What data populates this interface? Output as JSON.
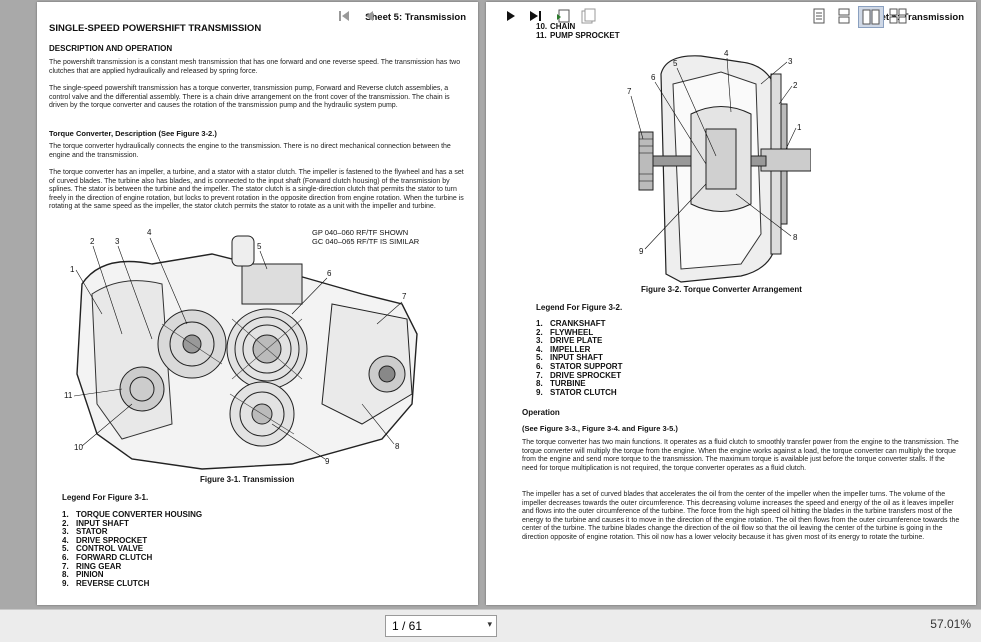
{
  "page1": {
    "sheet": "Sheet 5: Transmission",
    "title": "SINGLE-SPEED POWERSHIFT TRANSMISSION",
    "desc_heading": "DESCRIPTION AND OPERATION",
    "p1": "The powershift transmission is a constant mesh transmission that has one forward and one reverse speed. The transmission has two clutches that are applied hydraulically and released by spring force.",
    "p2": "The single-speed powershift transmission has a torque converter, transmission pump, Forward and Reverse clutch assemblies, a control valve and the differential assembly. There is a chain drive arrangement on the front cover of the transmission. The chain is driven by the torque converter and causes the rotation of the transmission pump and the hydraulic system pump.",
    "tc_heading": "Torque Converter, Description (See Figure 3-2.)",
    "p3": "The torque converter hydraulically connects the engine to the transmission. There is no direct mechanical connection between the engine and the transmission.",
    "p4": "The torque converter has an impeller, a turbine, and a stator with a stator clutch. The impeller is fastened to the flywheel and has a set of curved blades. The turbine also has blades, and is connected to the input shaft (Forward clutch housing) of the transmission by splines. The stator is between the turbine and the impeller. The stator clutch is a single-direction clutch that permits the stator to turn freely in the direction of engine rotation, but locks to prevent rotation in the opposite direction from engine rotation. When the turbine is rotating at the same speed as the impeller, the stator clutch permits the stator to rotate as a unit with the impeller and turbine.",
    "note1": "GP 040–060 RF/TF SHOWN",
    "note2": "GC 040–065 RF/TF IS SIMILAR",
    "fig_caption": "Figure 3-1. Transmission",
    "legend_title": "Legend For Figure 3-1.",
    "legend": [
      {
        "n": "1.",
        "t": "TORQUE CONVERTER HOUSING"
      },
      {
        "n": "2.",
        "t": "INPUT SHAFT"
      },
      {
        "n": "3.",
        "t": "STATOR"
      },
      {
        "n": "4.",
        "t": "DRIVE SPROCKET"
      },
      {
        "n": "5.",
        "t": "CONTROL VALVE"
      },
      {
        "n": "6.",
        "t": "FORWARD CLUTCH"
      },
      {
        "n": "7.",
        "t": "RING GEAR"
      },
      {
        "n": "8.",
        "t": "PINION"
      },
      {
        "n": "9.",
        "t": "REVERSE CLUTCH"
      }
    ],
    "callouts": [
      "1",
      "2",
      "3",
      "4",
      "5",
      "6",
      "7",
      "8",
      "9",
      "10",
      "11"
    ]
  },
  "page2": {
    "sheet": "Sheet 5: Transmission",
    "cont": [
      {
        "n": "10.",
        "t": "CHAIN"
      },
      {
        "n": "11.",
        "t": "PUMP SPROCKET"
      }
    ],
    "fig_caption": "Figure 3-2. Torque Converter Arrangement",
    "legend_title": "Legend For Figure 3-2.",
    "legend": [
      {
        "n": "1.",
        "t": "CRANKSHAFT"
      },
      {
        "n": "2.",
        "t": "FLYWHEEL"
      },
      {
        "n": "3.",
        "t": "DRIVE PLATE"
      },
      {
        "n": "4.",
        "t": "IMPELLER"
      },
      {
        "n": "5.",
        "t": "INPUT SHAFT"
      },
      {
        "n": "6.",
        "t": "STATOR SUPPORT"
      },
      {
        "n": "7.",
        "t": "DRIVE SPROCKET"
      },
      {
        "n": "8.",
        "t": "TURBINE"
      },
      {
        "n": "9.",
        "t": "STATOR CLUTCH"
      }
    ],
    "op_heading": "Operation",
    "op_see": "(See Figure 3-3., Figure 3-4. and Figure 3-5.)",
    "p1": "The torque converter has two main functions. It operates as a fluid clutch to smoothly transfer power from the engine to the transmission. The torque converter will multiply the torque from the engine. When the engine works against a load, the torque converter can multiply the torque from the engine and send more torque to the transmission. The maximum torque is available just before the torque converter stalls. If the need for torque multiplication is not required, the torque converter operates as a fluid clutch.",
    "p2": "The impeller has a set of curved blades that accelerates the oil from the center of the impeller when the impeller turns. The volume of the impeller decreases towards the outer circumference. This decreasing volume increases the speed and energy of the oil as it leaves impeller and flows into the outer circumference of the turbine. The force from the high speed oil hitting the blades in the turbine transfers most of the energy to the turbine and causes it to move in the direction of the engine rotation. The oil then flows from the outer circumference towards the center of the turbine. The turbine blades change the direction of the oil flow so that the oil leaving the center of the turbine is going in the direction opposite of engine rotation. This oil now has a lower velocity because it has given most of its energy to rotate the turbine.",
    "callouts": [
      "1",
      "2",
      "3",
      "4",
      "5",
      "6",
      "7",
      "8",
      "9"
    ]
  },
  "toolbar": {
    "page_value": "1 / 61",
    "zoom": "57.01%"
  }
}
